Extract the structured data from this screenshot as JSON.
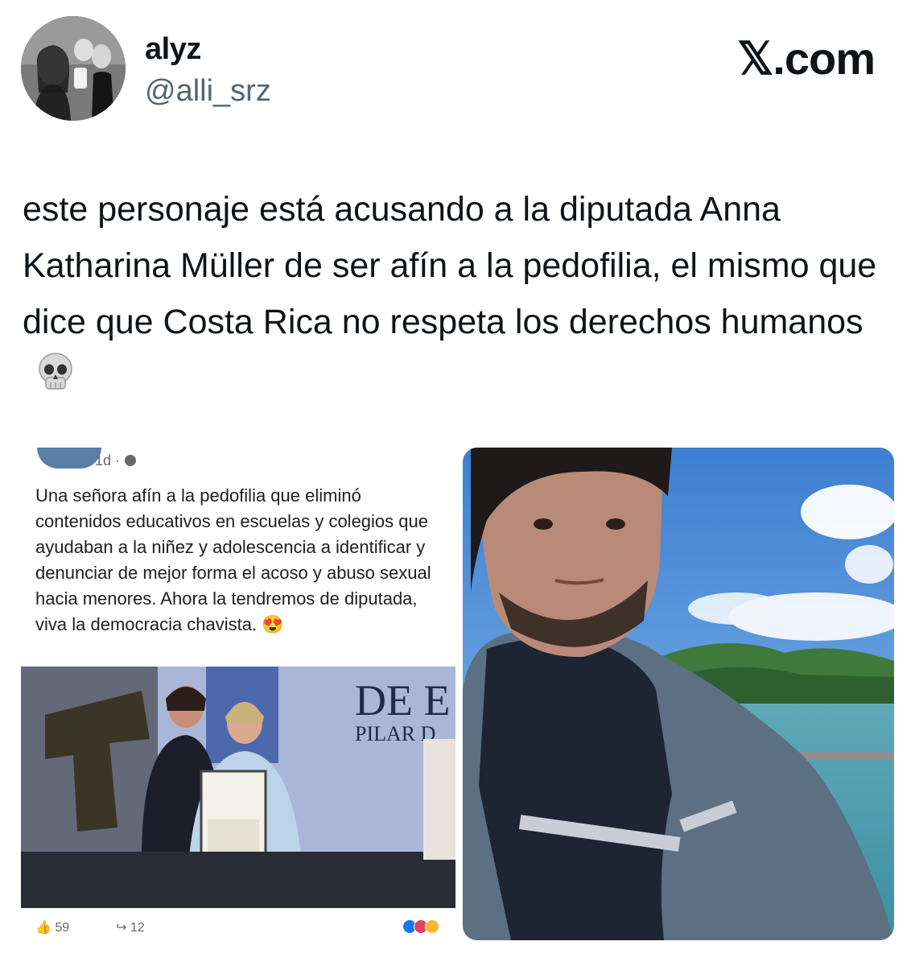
{
  "header": {
    "display_name": "alyz",
    "handle": "@alli_srz",
    "brand": "𝕏.com"
  },
  "tweet": {
    "text": "este personaje está acusando a la diputada Anna Katharina Müller de ser afín a la pedofilia, el mismo que dice que Costa Rica no respeta los derechos humanos",
    "emoji_icon": "skull-emoji"
  },
  "embedded_post": {
    "time": "1d ·",
    "body": "Una señora afín a la pedofilia que eliminó contenidos educativos en escuelas y colegios que ayudaban a la niñez y adolescencia a identificar y denunciar de mejor forma el acoso y abuso sexual hacia menores. Ahora la tendremos de diputada, viva la democracia chavista. 😍",
    "photo_sign_line1": "DE E",
    "photo_sign_line2": "PILAR D",
    "likes": "59",
    "shares": "12"
  },
  "colors": {
    "text": "#0f1419",
    "secondary": "#536471",
    "fb_gray": "#65676b"
  }
}
